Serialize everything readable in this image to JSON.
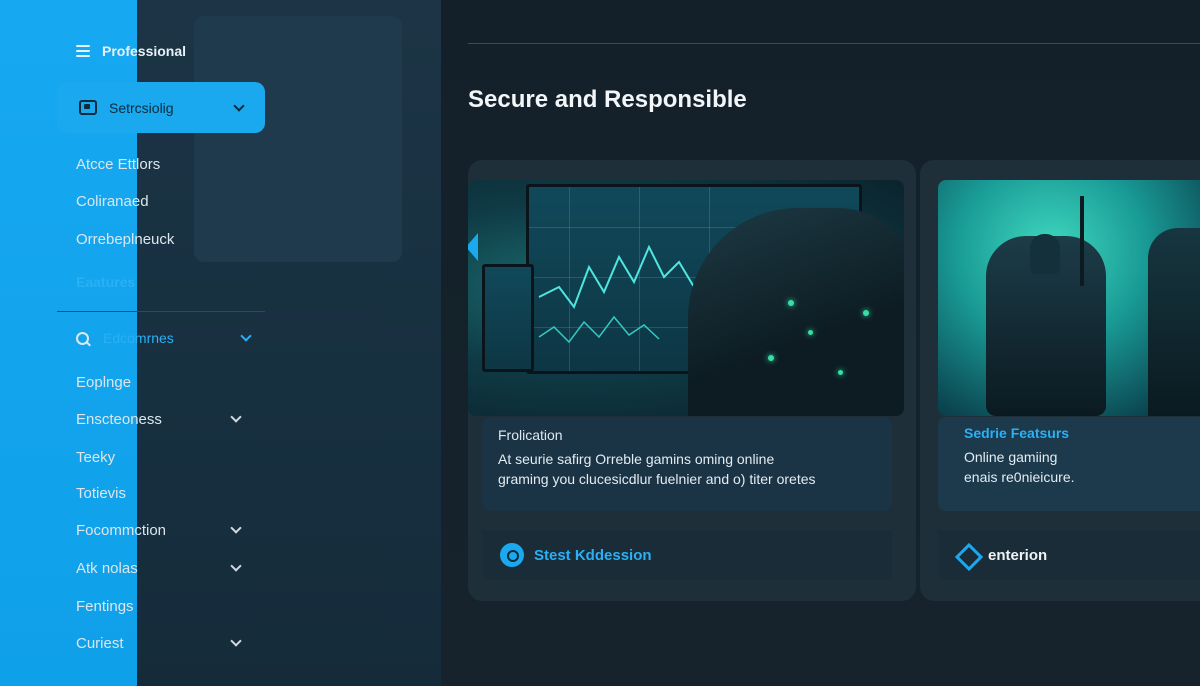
{
  "sidebar": {
    "header": "Professional",
    "active_item": "Setrcsiolig",
    "sub_items": [
      "Atcce Ettlors",
      "Coliranaed",
      "Orrebeplneuck"
    ],
    "section_label": "Eaatures",
    "search_label": "Edcomrnes",
    "items": [
      {
        "label": "Eoplnge",
        "has_chevron": false
      },
      {
        "label": "Enscteoness",
        "has_chevron": true
      },
      {
        "label": "Teeky",
        "has_chevron": false
      },
      {
        "label": "Totievis",
        "has_chevron": false
      },
      {
        "label": "Focommction",
        "has_chevron": true
      },
      {
        "label": "Atk nolas",
        "has_chevron": true
      },
      {
        "label": "Fentings",
        "has_chevron": false
      },
      {
        "label": "Curiest",
        "has_chevron": true
      }
    ]
  },
  "main": {
    "title": "Secure and Responsible",
    "cards": [
      {
        "caption_title": "Frolication",
        "caption_line1": "At seurie safirg Orreble gamins oming online",
        "caption_line2": "graming you clucesicdlur fuelnier and o) titer oretes",
        "footer": "Stest Kddession"
      },
      {
        "caption_title": "Sedrie Featsurs",
        "caption_line1": "Online gamiing",
        "caption_line2": "enais re0nieicure.",
        "footer": "enterion"
      }
    ]
  },
  "colors": {
    "accent": "#1aa9ee",
    "sidebar_bg": "#1c3445",
    "content_bg": "#132029"
  }
}
